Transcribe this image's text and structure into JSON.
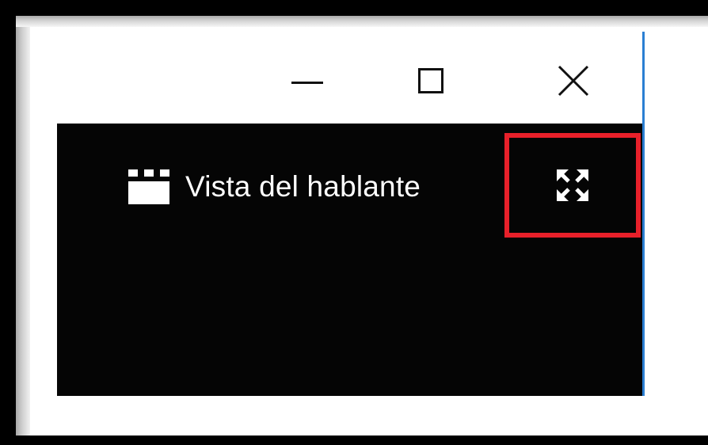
{
  "window": {
    "controls": [
      {
        "name": "minimize-button",
        "icon": "minimize-icon"
      },
      {
        "name": "maximize-button",
        "icon": "maximize-icon"
      },
      {
        "name": "close-button",
        "icon": "close-icon"
      }
    ]
  },
  "toolbar": {
    "view_label": "Vista del hablante",
    "view_icon": "speaker-view-icon",
    "fullscreen_icon": "fullscreen-icon"
  },
  "colors": {
    "panel_background": "#050505",
    "titlebar_background": "#ffffff",
    "highlight": "#e8202a",
    "accent": "#2b7fd3",
    "text": "#ffffff"
  }
}
